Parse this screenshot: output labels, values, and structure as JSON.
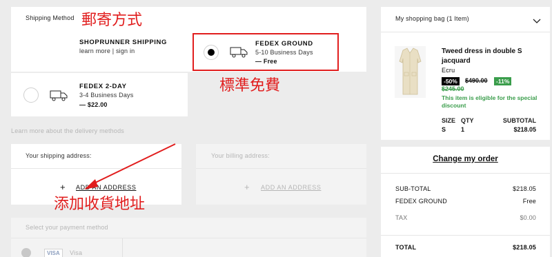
{
  "annotations": {
    "shipping_method": "郵寄方式",
    "free_standard": "標準免費",
    "add_address": "添加收貨地址"
  },
  "shipping": {
    "section_title": "Shipping Method",
    "shoprunner": {
      "title": "SHOPRUNNER SHIPPING",
      "links": "learn more | sign in"
    },
    "fedex_ground": {
      "title": "FEDEX GROUND",
      "days": "5-10 Business Days",
      "price": "— Free"
    },
    "fedex_2day": {
      "title": "FEDEX 2-DAY",
      "days": "3-4 Business Days",
      "price": "— $22.00"
    },
    "learn_more": "Learn more about the delivery methods"
  },
  "address": {
    "shipping_label": "Your shipping address:",
    "billing_label": "Your billing address:",
    "add_address": "ADD AN ADDRESS",
    "plus": "+"
  },
  "payment": {
    "label": "Select your payment method",
    "visa_badge": "VISA",
    "visa_label": "Visa"
  },
  "bag": {
    "title": "My shopping bag (1 Item)",
    "item": {
      "name": "Tweed dress in double S jacquard",
      "color": "Ecru",
      "discount": "-50%",
      "old_price": "$490.00",
      "extra": "-11%",
      "sale_price": "$245.00",
      "special_note": "This item is eligible for the special discount",
      "headers": {
        "size": "SIZE",
        "qty": "QTY",
        "subtotal": "SUBTOTAL"
      },
      "values": {
        "size": "S",
        "qty": "1",
        "subtotal": "$218.05"
      }
    }
  },
  "order": {
    "change_label": "Change my order",
    "subtotal_label": "SUB-TOTAL",
    "subtotal_value": "$218.05",
    "shipping_label": "FEDEX GROUND",
    "shipping_value": "Free",
    "tax_label": "TAX",
    "tax_value": "$0.00",
    "total_label": "TOTAL",
    "total_value": "$218.05"
  },
  "colors": {
    "accent_red": "#e11d1d",
    "green": "#3a9d4b",
    "muted": "#b5b5b5"
  }
}
